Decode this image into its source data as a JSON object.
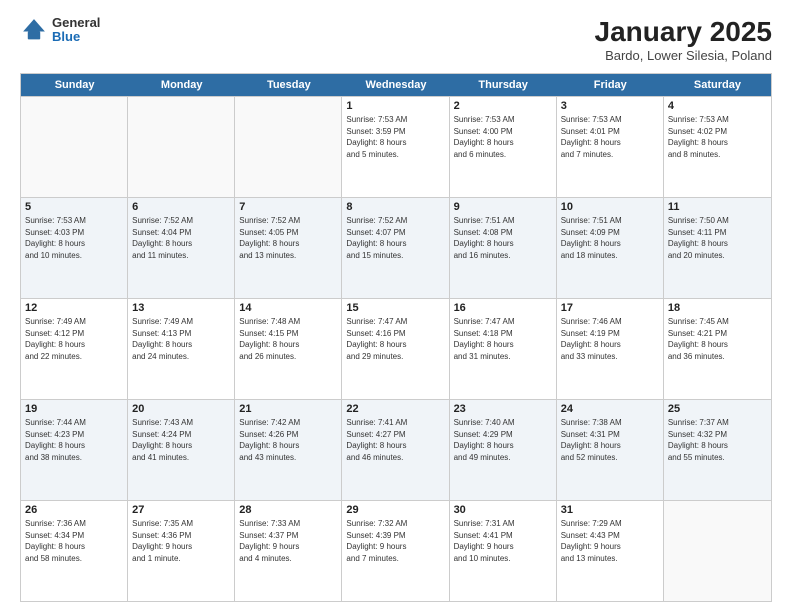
{
  "header": {
    "logo": {
      "general": "General",
      "blue": "Blue"
    },
    "title": "January 2025",
    "subtitle": "Bardo, Lower Silesia, Poland"
  },
  "days_of_week": [
    "Sunday",
    "Monday",
    "Tuesday",
    "Wednesday",
    "Thursday",
    "Friday",
    "Saturday"
  ],
  "weeks": [
    [
      {
        "day": "",
        "info": ""
      },
      {
        "day": "",
        "info": ""
      },
      {
        "day": "",
        "info": ""
      },
      {
        "day": "1",
        "info": "Sunrise: 7:53 AM\nSunset: 3:59 PM\nDaylight: 8 hours\nand 5 minutes."
      },
      {
        "day": "2",
        "info": "Sunrise: 7:53 AM\nSunset: 4:00 PM\nDaylight: 8 hours\nand 6 minutes."
      },
      {
        "day": "3",
        "info": "Sunrise: 7:53 AM\nSunset: 4:01 PM\nDaylight: 8 hours\nand 7 minutes."
      },
      {
        "day": "4",
        "info": "Sunrise: 7:53 AM\nSunset: 4:02 PM\nDaylight: 8 hours\nand 8 minutes."
      }
    ],
    [
      {
        "day": "5",
        "info": "Sunrise: 7:53 AM\nSunset: 4:03 PM\nDaylight: 8 hours\nand 10 minutes."
      },
      {
        "day": "6",
        "info": "Sunrise: 7:52 AM\nSunset: 4:04 PM\nDaylight: 8 hours\nand 11 minutes."
      },
      {
        "day": "7",
        "info": "Sunrise: 7:52 AM\nSunset: 4:05 PM\nDaylight: 8 hours\nand 13 minutes."
      },
      {
        "day": "8",
        "info": "Sunrise: 7:52 AM\nSunset: 4:07 PM\nDaylight: 8 hours\nand 15 minutes."
      },
      {
        "day": "9",
        "info": "Sunrise: 7:51 AM\nSunset: 4:08 PM\nDaylight: 8 hours\nand 16 minutes."
      },
      {
        "day": "10",
        "info": "Sunrise: 7:51 AM\nSunset: 4:09 PM\nDaylight: 8 hours\nand 18 minutes."
      },
      {
        "day": "11",
        "info": "Sunrise: 7:50 AM\nSunset: 4:11 PM\nDaylight: 8 hours\nand 20 minutes."
      }
    ],
    [
      {
        "day": "12",
        "info": "Sunrise: 7:49 AM\nSunset: 4:12 PM\nDaylight: 8 hours\nand 22 minutes."
      },
      {
        "day": "13",
        "info": "Sunrise: 7:49 AM\nSunset: 4:13 PM\nDaylight: 8 hours\nand 24 minutes."
      },
      {
        "day": "14",
        "info": "Sunrise: 7:48 AM\nSunset: 4:15 PM\nDaylight: 8 hours\nand 26 minutes."
      },
      {
        "day": "15",
        "info": "Sunrise: 7:47 AM\nSunset: 4:16 PM\nDaylight: 8 hours\nand 29 minutes."
      },
      {
        "day": "16",
        "info": "Sunrise: 7:47 AM\nSunset: 4:18 PM\nDaylight: 8 hours\nand 31 minutes."
      },
      {
        "day": "17",
        "info": "Sunrise: 7:46 AM\nSunset: 4:19 PM\nDaylight: 8 hours\nand 33 minutes."
      },
      {
        "day": "18",
        "info": "Sunrise: 7:45 AM\nSunset: 4:21 PM\nDaylight: 8 hours\nand 36 minutes."
      }
    ],
    [
      {
        "day": "19",
        "info": "Sunrise: 7:44 AM\nSunset: 4:23 PM\nDaylight: 8 hours\nand 38 minutes."
      },
      {
        "day": "20",
        "info": "Sunrise: 7:43 AM\nSunset: 4:24 PM\nDaylight: 8 hours\nand 41 minutes."
      },
      {
        "day": "21",
        "info": "Sunrise: 7:42 AM\nSunset: 4:26 PM\nDaylight: 8 hours\nand 43 minutes."
      },
      {
        "day": "22",
        "info": "Sunrise: 7:41 AM\nSunset: 4:27 PM\nDaylight: 8 hours\nand 46 minutes."
      },
      {
        "day": "23",
        "info": "Sunrise: 7:40 AM\nSunset: 4:29 PM\nDaylight: 8 hours\nand 49 minutes."
      },
      {
        "day": "24",
        "info": "Sunrise: 7:38 AM\nSunset: 4:31 PM\nDaylight: 8 hours\nand 52 minutes."
      },
      {
        "day": "25",
        "info": "Sunrise: 7:37 AM\nSunset: 4:32 PM\nDaylight: 8 hours\nand 55 minutes."
      }
    ],
    [
      {
        "day": "26",
        "info": "Sunrise: 7:36 AM\nSunset: 4:34 PM\nDaylight: 8 hours\nand 58 minutes."
      },
      {
        "day": "27",
        "info": "Sunrise: 7:35 AM\nSunset: 4:36 PM\nDaylight: 9 hours\nand 1 minute."
      },
      {
        "day": "28",
        "info": "Sunrise: 7:33 AM\nSunset: 4:37 PM\nDaylight: 9 hours\nand 4 minutes."
      },
      {
        "day": "29",
        "info": "Sunrise: 7:32 AM\nSunset: 4:39 PM\nDaylight: 9 hours\nand 7 minutes."
      },
      {
        "day": "30",
        "info": "Sunrise: 7:31 AM\nSunset: 4:41 PM\nDaylight: 9 hours\nand 10 minutes."
      },
      {
        "day": "31",
        "info": "Sunrise: 7:29 AM\nSunset: 4:43 PM\nDaylight: 9 hours\nand 13 minutes."
      },
      {
        "day": "",
        "info": ""
      }
    ]
  ]
}
